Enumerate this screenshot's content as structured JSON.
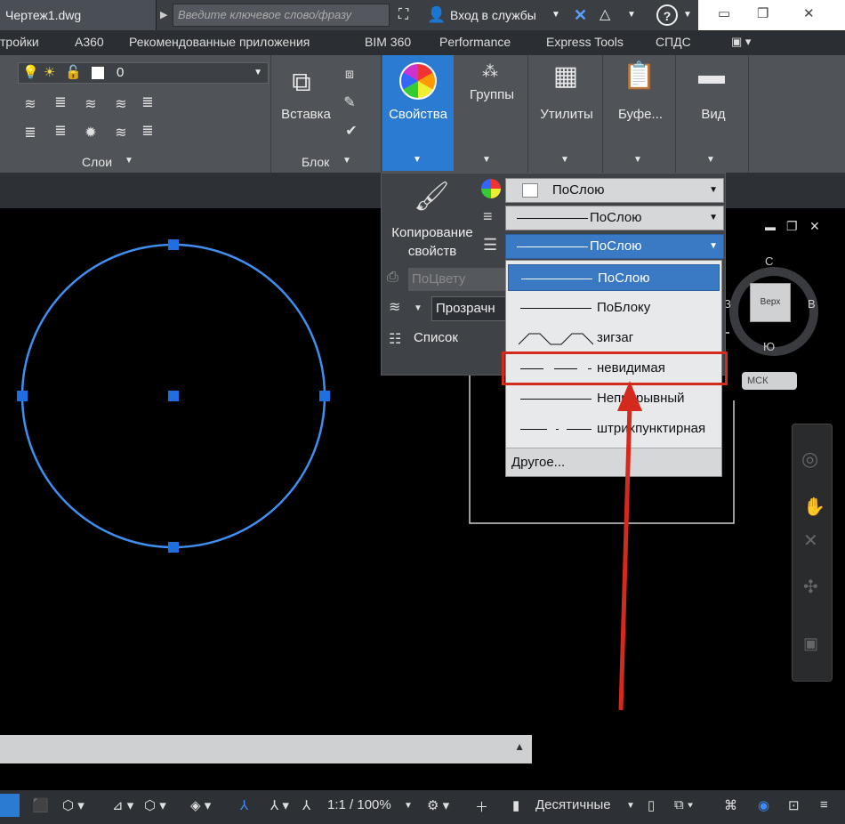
{
  "titlebar": {
    "doc_tab": "Чертеж1.dwg",
    "search_placeholder": "Введите ключевое слово/фразу",
    "signin": "Вход в службы"
  },
  "menu": [
    "тройки",
    "А360",
    "Рекомендованные приложения",
    "BIM 360",
    "Performance",
    "Express Tools",
    "СПДС"
  ],
  "ribbon": {
    "layer_value": "0",
    "layers_label": "Слои",
    "insert_label": "Вставка",
    "block_label": "Блок",
    "properties_label": "Свойства",
    "groups_label": "Группы",
    "utilities_label": "Утилиты",
    "clipboard_label": "Буфе...",
    "view_label": "Вид"
  },
  "props_panel": {
    "copy_props": "Копирование свойств",
    "color_combo": "ПоСлою",
    "lineweight_combo": "ПоСлою",
    "linetype_combo": "ПоСлою",
    "plot_style": "ПоЦвету",
    "transparency": "Прозрачн",
    "list_label": "Список"
  },
  "linetype_dropdown": {
    "items": [
      "ПоСлою",
      "ПоБлоку",
      "зигзаг",
      "невидимая",
      "Непрерывный",
      "штрихпунктирная"
    ],
    "other": "Другое..."
  },
  "viewcube": {
    "north": "С",
    "east": "В",
    "south": "Ю",
    "west": "З",
    "face": "Верх",
    "wcs": "МСК"
  },
  "statusbar": {
    "scale": "1:1 / 100%",
    "units": "Десятичные"
  },
  "colors": {
    "accent": "#2a7bd1",
    "circle": "#3f8ff0",
    "highlight": "#d42a1e"
  }
}
